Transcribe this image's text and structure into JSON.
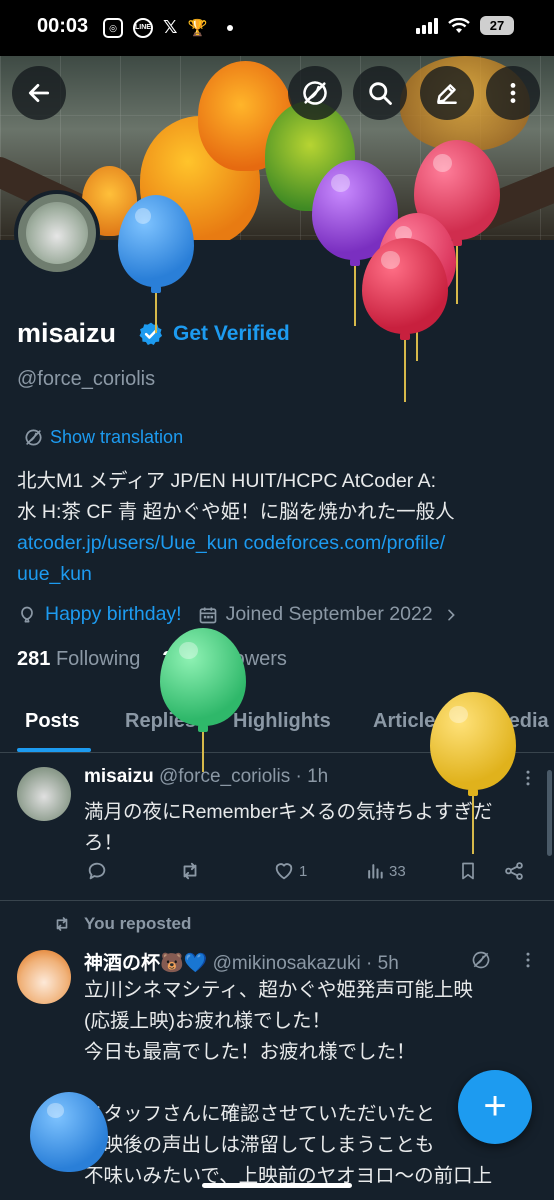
{
  "status_bar": {
    "time": "00:03",
    "app_icons": [
      "instagram-icon",
      "line-icon",
      "x-icon",
      "trophy-icon"
    ],
    "app_icon_labels": [
      "◎",
      "LINE",
      "𝕏",
      "🏆"
    ],
    "battery": "27"
  },
  "header": {
    "buttons": [
      "back-arrow-icon",
      "translate-off-icon",
      "search-icon",
      "edit-icon",
      "more-icon"
    ]
  },
  "profile": {
    "name": "misaizu",
    "get_verified": "Get Verified",
    "handle": "@force_coriolis",
    "show_translation": "Show translation",
    "bio_line1": "北大M1 メディア JP/EN HUIT/HCPC AtCoder A:",
    "bio_line2": "水 H:茶 CF 青  超かぐや姫！に脳を焼かれた一般人",
    "bio_link1": "atcoder.jp/users/Uue_kun",
    "bio_link2": "codeforces.com/profile/",
    "bio_link2b": "uue_kun",
    "birthday": "Happy birthday!",
    "joined": "Joined September 2022",
    "following_count": "281",
    "following_label": "Following",
    "followers_count": "297",
    "followers_label": "Followers"
  },
  "tabs": [
    "Posts",
    "Replies",
    "Highlights",
    "Articles",
    "Media"
  ],
  "posts": [
    {
      "name": "misaizu",
      "handle": "@force_coriolis",
      "time": "· 1h",
      "text_line1": "満月の夜にRememberキメるの気持ちよすぎだ",
      "text_line2": "ろ！",
      "replies": "",
      "reposts": "",
      "likes": "1",
      "views": "33"
    },
    {
      "reposted_label": "You reposted",
      "name": "神酒の杯🐻💙",
      "handle": "@mikinosakazuki",
      "time": "· 5h",
      "lines": [
        "立川シネマシティ、超かぐや姫発声可能上映",
        "(応援上映)お疲れ様でした！",
        "今日も最高でした！お疲れ様でした！",
        "",
        "スタッフさんに確認させていただいたと",
        "上映後の声出しは滞留してしまうことも",
        "不味いみたいで、上映前のヤオヨロ〜の前口上"
      ]
    }
  ],
  "fab": "+",
  "colors": {
    "background": "#15202b",
    "accent": "#1d9bf0",
    "secondary_text": "#8b98a5",
    "border": "#38444d"
  }
}
